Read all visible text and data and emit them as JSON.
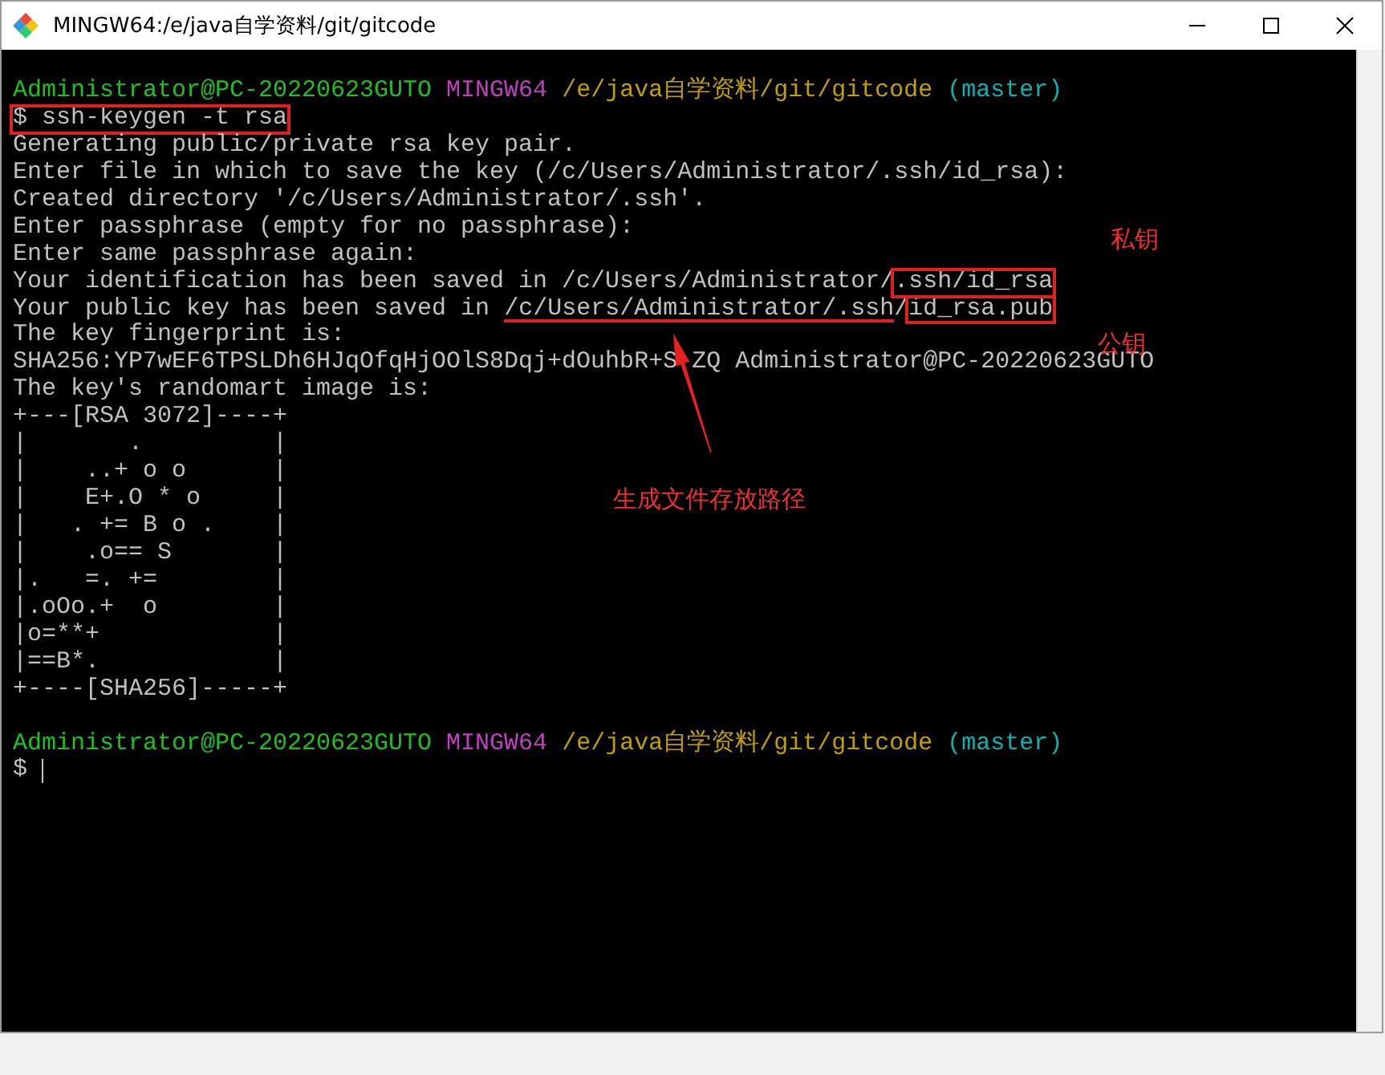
{
  "window": {
    "title": "MINGW64:/e/java自学资料/git/gitcode"
  },
  "terminal": {
    "lines": [
      {
        "kind": "prompt",
        "segments": [
          {
            "text": "Administrator@PC-20220623GUTO",
            "kind": "user"
          },
          {
            "text": "MINGW64",
            "kind": "host"
          },
          {
            "text": "/e/java自学资料/git/gitcode",
            "kind": "path"
          },
          {
            "text": "(master)",
            "kind": "branch"
          }
        ]
      },
      {
        "kind": "output",
        "segments": [
          {
            "text": "$ ssh-keygen -t rsa",
            "kind": "boxed"
          }
        ]
      },
      {
        "kind": "output",
        "segments": [
          {
            "text": "Generating public/private rsa key pair.",
            "kind": "output"
          }
        ]
      },
      {
        "kind": "output",
        "segments": [
          {
            "text": "Enter file in which to save the key (/c/Users/Administrator/.ssh/id_rsa):",
            "kind": "output"
          }
        ]
      },
      {
        "kind": "output",
        "segments": [
          {
            "text": "Created directory '/c/Users/Administrator/.ssh'.",
            "kind": "output"
          }
        ]
      },
      {
        "kind": "output",
        "segments": [
          {
            "text": "Enter passphrase (empty for no passphrase):",
            "kind": "output"
          }
        ]
      },
      {
        "kind": "output",
        "segments": [
          {
            "text": "Enter same passphrase again:",
            "kind": "output"
          }
        ]
      },
      {
        "kind": "output",
        "segments": [
          {
            "text": "Your identification has been saved in /c/Users/Administrator/",
            "kind": "output"
          },
          {
            "text": ".ssh/id_rsa",
            "kind": "boxed"
          }
        ]
      },
      {
        "kind": "output",
        "segments": [
          {
            "text": "Your public key has been saved in ",
            "kind": "output"
          },
          {
            "text": "/c/Users/Administrator/.ssh",
            "kind": "underlined"
          },
          {
            "text": "/",
            "kind": "output"
          },
          {
            "text": "id_rsa.pub",
            "kind": "boxed"
          }
        ]
      },
      {
        "kind": "output",
        "segments": [
          {
            "text": "The key fingerprint is:",
            "kind": "output"
          }
        ]
      },
      {
        "kind": "split",
        "segments": [
          {
            "text": "SHA256:YP7wEF6TPSLDh6HJqOfqHjOOlS8Dqj+dOuhbR+S",
            "kind": "output"
          },
          {
            "text": "ZQ Administrator@PC-20220623GUTO",
            "kind": "output"
          }
        ]
      },
      {
        "kind": "output",
        "segments": [
          {
            "text": "The key's randomart image is:",
            "kind": "output"
          }
        ]
      },
      {
        "kind": "output",
        "segments": [
          {
            "text": "+---[RSA 3072]----+",
            "kind": "output"
          }
        ]
      },
      {
        "kind": "output",
        "segments": [
          {
            "text": "|       .         |",
            "kind": "output"
          }
        ]
      },
      {
        "kind": "output",
        "segments": [
          {
            "text": "|    ..+ o o      |",
            "kind": "output"
          }
        ]
      },
      {
        "kind": "output",
        "segments": [
          {
            "text": "|    E+.O * o     |",
            "kind": "output"
          }
        ]
      },
      {
        "kind": "output",
        "segments": [
          {
            "text": "|   . += B o .    |",
            "kind": "output"
          }
        ]
      },
      {
        "kind": "output",
        "segments": [
          {
            "text": "|    .o== S       |",
            "kind": "output"
          }
        ]
      },
      {
        "kind": "output",
        "segments": [
          {
            "text": "|.   =. +=        |",
            "kind": "output"
          }
        ]
      },
      {
        "kind": "output",
        "segments": [
          {
            "text": "|.oOo.+  o        |",
            "kind": "output"
          }
        ]
      },
      {
        "kind": "output",
        "segments": [
          {
            "text": "|o=**+            |",
            "kind": "output"
          }
        ]
      },
      {
        "kind": "output",
        "segments": [
          {
            "text": "|==B*.            |",
            "kind": "output"
          }
        ]
      },
      {
        "kind": "output",
        "segments": [
          {
            "text": "+----[SHA256]-----+",
            "kind": "output"
          }
        ]
      },
      {
        "kind": "blank"
      },
      {
        "kind": "prompt",
        "segments": [
          {
            "text": "Administrator@PC-20220623GUTO",
            "kind": "user"
          },
          {
            "text": "MINGW64",
            "kind": "host"
          },
          {
            "text": "/e/java自学资料/git/gitcode",
            "kind": "path"
          },
          {
            "text": "(master)",
            "kind": "branch"
          }
        ]
      },
      {
        "kind": "output",
        "segments": [
          {
            "text": "$",
            "kind": "output"
          }
        ],
        "cursor": true
      }
    ]
  },
  "annotations": [
    {
      "text": "私钥"
    },
    {
      "text": "公钥"
    },
    {
      "text": "生成文件存放路径"
    }
  ]
}
